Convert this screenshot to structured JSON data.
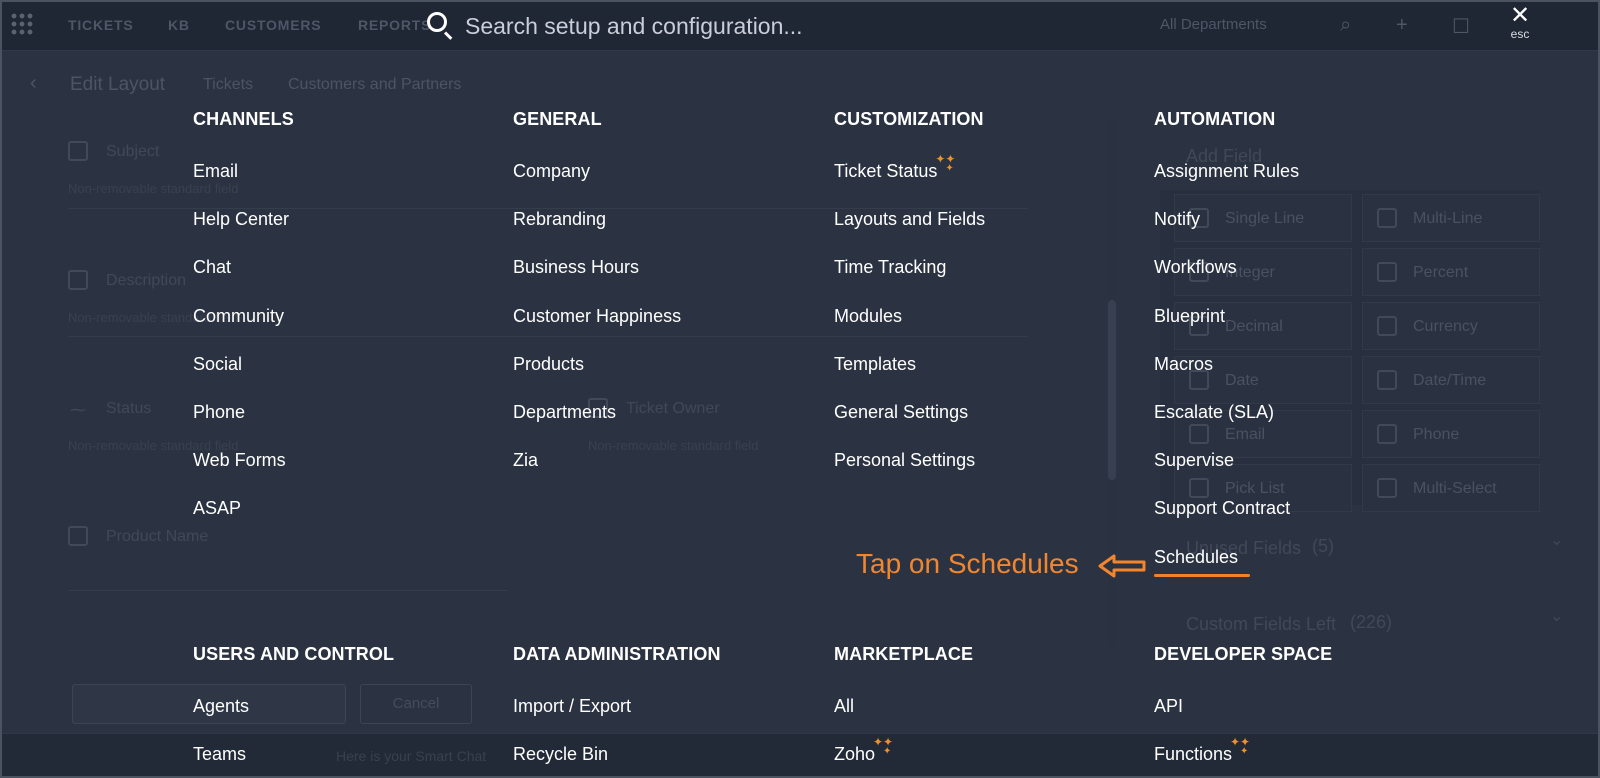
{
  "background": {
    "nav": [
      "TICKETS",
      "KB",
      "CUSTOMERS",
      "REPORTS"
    ],
    "department": "All Departments",
    "breadcrumb": {
      "title": "Edit Layout",
      "crumb1": "Tickets",
      "crumb2": "Customers and Partners"
    },
    "fields": [
      {
        "label": "Subject",
        "note": "Non-removable standard field"
      },
      {
        "label": "Description",
        "note": "Non-removable standard field"
      },
      {
        "label": "Status",
        "note": "Non-removable standard field"
      },
      {
        "label": "Ticket Owner",
        "note": "Non-removable standard field"
      },
      {
        "label": "Product Name",
        "note": ""
      }
    ],
    "add_field": {
      "title": "Add Field",
      "types": [
        "Single Line",
        "Multi-Line",
        "Integer",
        "Percent",
        "Decimal",
        "Currency",
        "Date",
        "Date/Time",
        "Email",
        "Phone",
        "Pick List",
        "Multi-Select"
      ],
      "unused_label": "Unused Fields",
      "unused_count": "(5)",
      "custom_label": "Custom Fields Left",
      "custom_count": "(226)"
    },
    "cancel_label": "Cancel",
    "bottom_placeholder": "Here is your Smart Chat"
  },
  "search": {
    "placeholder": "Search setup and configuration..."
  },
  "close": {
    "label": "esc"
  },
  "menu": {
    "channels": {
      "heading": "CHANNELS",
      "items": [
        "Email",
        "Help Center",
        "Chat",
        "Community",
        "Social",
        "Phone",
        "Web Forms",
        "ASAP"
      ]
    },
    "general": {
      "heading": "GENERAL",
      "items": [
        "Company",
        "Rebranding",
        "Business Hours",
        "Customer Happiness",
        "Products",
        "Departments",
        "Zia"
      ]
    },
    "customization": {
      "heading": "CUSTOMIZATION",
      "items": [
        "Ticket Status",
        "Layouts and Fields",
        "Time Tracking",
        "Modules",
        "Templates",
        "General Settings",
        "Personal Settings"
      ]
    },
    "automation": {
      "heading": "AUTOMATION",
      "items": [
        "Assignment Rules",
        "Notify",
        "Workflows",
        "Blueprint",
        "Macros",
        "Escalate (SLA)",
        "Supervise",
        "Support Contract",
        "Schedules"
      ]
    },
    "users_control": {
      "heading": "USERS AND CONTROL",
      "items": [
        "Agents",
        "Teams"
      ]
    },
    "data_admin": {
      "heading": "DATA ADMINISTRATION",
      "items": [
        "Import / Export",
        "Recycle Bin"
      ]
    },
    "marketplace": {
      "heading": "MARKETPLACE",
      "items": [
        "All",
        "Zoho"
      ]
    },
    "developer": {
      "heading": "DEVELOPER SPACE",
      "items": [
        "API",
        "Functions"
      ]
    }
  },
  "annotation": {
    "text": "Tap on Schedules",
    "color": "#f2862e"
  },
  "colors": {
    "overlay": "#262d3b",
    "accent": "#f0822a",
    "text": "#ffffff"
  },
  "icons": {
    "search": "search-icon",
    "close": "close-icon",
    "new": "sparkle-icon",
    "apps": "apps-grid-icon"
  }
}
